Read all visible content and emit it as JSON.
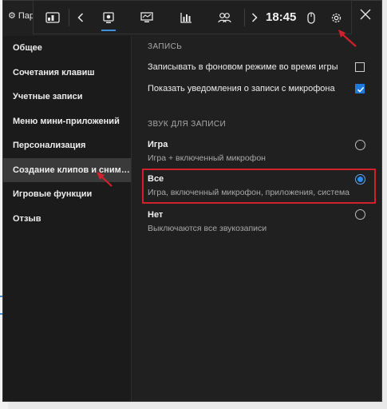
{
  "window": {
    "title": "Пар",
    "close_icon": "close-icon"
  },
  "gamebar": {
    "time": "18:45",
    "icons": [
      "widget-menu-icon",
      "chevron-left-icon",
      "capture-icon",
      "performance-icon",
      "stats-icon",
      "social-icon",
      "chevron-right-icon",
      "mouse-icon",
      "gear-icon"
    ],
    "accent": "#3e8ede"
  },
  "nav": {
    "items": [
      {
        "label": "Общее"
      },
      {
        "label": "Сочетания клавиш"
      },
      {
        "label": "Учетные записи"
      },
      {
        "label": "Меню мини-приложений"
      },
      {
        "label": "Персонализация"
      },
      {
        "label": "Создание клипов и снимк..."
      },
      {
        "label": "Игровые функции"
      },
      {
        "label": "Отзыв"
      }
    ],
    "active_index": 5
  },
  "recording": {
    "heading": "ЗАПИСЬ",
    "background_record_label": "Записывать в фоновом режиме во время игры",
    "background_record_checked": false,
    "mic_notification_label": "Показать уведомления о записи с микрофона",
    "mic_notification_checked": true
  },
  "audio": {
    "heading": "ЗВУК ДЛЯ ЗАПИСИ",
    "options": [
      {
        "title": "Игра",
        "subtitle": "Игра + включенный микрофон",
        "selected": false
      },
      {
        "title": "Все",
        "subtitle": "Игра, включенный микрофон, приложения, система",
        "selected": true
      },
      {
        "title": "Нет",
        "subtitle": "Выключаются все звукозаписи",
        "selected": false
      }
    ]
  },
  "colors": {
    "accent": "#1d7be0",
    "annotation": "#d1212c"
  }
}
